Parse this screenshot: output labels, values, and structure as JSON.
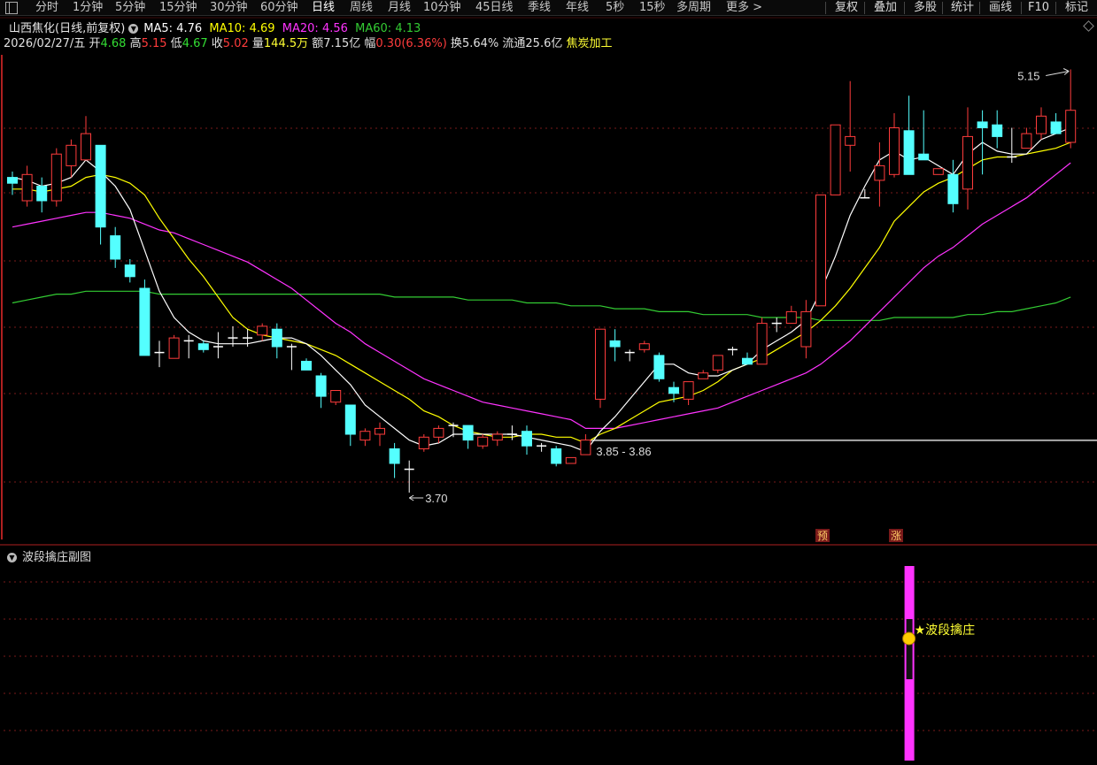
{
  "toolbar": {
    "periods": [
      "分时",
      "1分钟",
      "5分钟",
      "15分钟",
      "30分钟",
      "60分钟",
      "日线",
      "周线",
      "月线",
      "10分钟",
      "45日线",
      "季线",
      "年线",
      "5秒",
      "15秒",
      "多周期",
      "更多 >"
    ],
    "active": "日线",
    "right_buttons": [
      "复权",
      "叠加",
      "多股",
      "统计",
      "画线",
      "F10",
      "标记"
    ]
  },
  "header": {
    "stock": "山西焦化",
    "mode": "(日线,前复权)",
    "ma5": "MA5: 4.76",
    "ma10": "MA10: 4.69",
    "ma20": "MA20: 4.56",
    "ma60": "MA60: 4.13",
    "date": "2026/02/27/五",
    "open_label": "开",
    "open": "4.68",
    "high_label": "高",
    "high": "5.15",
    "low_label": "低",
    "low": "4.67",
    "close_label": "收",
    "close": "5.02",
    "vol_label": "量",
    "vol": "144.5万",
    "amt_label": "额",
    "amt": "7.15亿",
    "chg_label": "幅",
    "chg": "0.30(6.36%)",
    "turn_label": "换",
    "turn": "5.64%",
    "float_label": "流通",
    "float": "25.6亿",
    "industry": "焦炭加工"
  },
  "colors": {
    "up": "#ff3c3c",
    "down": "#54ffff",
    "ma5": "#ffffff",
    "ma10": "#ffff00",
    "ma20": "#ff33ff",
    "ma60": "#33cc33",
    "grid": "#7a1a1a",
    "sub_bar": "#ff33ff",
    "label_yellow": "#ffff33"
  },
  "chart_data": {
    "type": "candlestick",
    "y_range": [
      3.6,
      5.2
    ],
    "candles": [
      [
        4.78,
        4.8,
        4.72,
        4.76
      ],
      [
        4.7,
        4.82,
        4.68,
        4.79
      ],
      [
        4.75,
        4.78,
        4.66,
        4.7
      ],
      [
        4.7,
        4.88,
        4.68,
        4.86
      ],
      [
        4.82,
        4.91,
        4.78,
        4.89
      ],
      [
        4.84,
        4.99,
        4.84,
        4.93
      ],
      [
        4.89,
        4.89,
        4.55,
        4.61
      ],
      [
        4.58,
        4.61,
        4.47,
        4.5
      ],
      [
        4.48,
        4.5,
        4.42,
        4.44
      ],
      [
        4.4,
        4.43,
        4.19,
        4.17
      ],
      [
        4.18,
        4.22,
        4.13,
        4.17
      ],
      [
        4.16,
        4.24,
        4.16,
        4.23
      ],
      [
        4.22,
        4.24,
        4.16,
        4.22
      ],
      [
        4.21,
        4.22,
        4.18,
        4.19
      ],
      [
        4.2,
        4.25,
        4.16,
        4.2
      ],
      [
        4.22,
        4.27,
        4.2,
        4.23
      ],
      [
        4.22,
        4.26,
        4.2,
        4.23
      ],
      [
        4.24,
        4.28,
        4.22,
        4.27
      ],
      [
        4.26,
        4.28,
        4.16,
        4.2
      ],
      [
        4.2,
        4.21,
        4.12,
        4.2
      ],
      [
        4.15,
        4.16,
        4.12,
        4.12
      ],
      [
        4.1,
        4.11,
        3.99,
        4.03
      ],
      [
        4.01,
        4.05,
        4.0,
        4.05
      ],
      [
        4.0,
        4.0,
        3.86,
        3.9
      ],
      [
        3.88,
        3.92,
        3.86,
        3.91
      ],
      [
        3.9,
        3.94,
        3.86,
        3.92
      ],
      [
        3.85,
        3.87,
        3.75,
        3.8
      ],
      [
        3.78,
        3.81,
        3.7,
        3.78
      ],
      [
        3.85,
        3.9,
        3.84,
        3.89
      ],
      [
        3.89,
        3.93,
        3.87,
        3.92
      ],
      [
        3.92,
        3.94,
        3.89,
        3.93
      ],
      [
        3.93,
        3.93,
        3.85,
        3.88
      ],
      [
        3.86,
        3.9,
        3.85,
        3.89
      ],
      [
        3.88,
        3.91,
        3.86,
        3.9
      ],
      [
        3.9,
        3.93,
        3.88,
        3.9
      ],
      [
        3.91,
        3.93,
        3.83,
        3.86
      ],
      [
        3.85,
        3.87,
        3.84,
        3.86
      ],
      [
        3.85,
        3.86,
        3.79,
        3.8
      ],
      [
        3.8,
        3.82,
        3.81,
        3.82
      ],
      [
        3.83,
        3.9,
        3.83,
        3.88
      ],
      [
        4.02,
        4.26,
        3.99,
        4.26
      ],
      [
        4.22,
        4.26,
        4.15,
        4.2
      ],
      [
        4.17,
        4.19,
        4.15,
        4.18
      ],
      [
        4.19,
        4.22,
        4.18,
        4.21
      ],
      [
        4.17,
        4.18,
        4.08,
        4.09
      ],
      [
        4.06,
        4.08,
        4.01,
        4.04
      ],
      [
        4.02,
        4.08,
        4.0,
        4.08
      ],
      [
        4.09,
        4.12,
        4.09,
        4.11
      ],
      [
        4.12,
        4.17,
        4.11,
        4.17
      ],
      [
        4.18,
        4.2,
        4.17,
        4.19
      ],
      [
        4.16,
        4.18,
        4.14,
        4.14
      ],
      [
        4.14,
        4.3,
        4.14,
        4.28
      ],
      [
        4.28,
        4.3,
        4.25,
        4.28
      ],
      [
        4.28,
        4.34,
        4.29,
        4.32
      ],
      [
        4.2,
        4.36,
        4.16,
        4.32
      ],
      [
        4.34,
        4.72,
        4.34,
        4.72
      ],
      [
        4.72,
        4.96,
        4.72,
        4.96
      ],
      [
        4.89,
        5.11,
        4.8,
        4.92
      ],
      [
        4.71,
        4.74,
        4.71,
        4.71
      ],
      [
        4.77,
        4.9,
        4.68,
        4.82
      ],
      [
        4.79,
        5.0,
        4.78,
        4.95
      ],
      [
        4.94,
        5.06,
        4.86,
        4.79
      ],
      [
        4.86,
        5.01,
        4.86,
        4.84
      ],
      [
        4.79,
        4.81,
        4.79,
        4.81
      ],
      [
        4.79,
        4.84,
        4.66,
        4.69
      ],
      [
        4.74,
        5.02,
        4.67,
        4.92
      ],
      [
        4.97,
        5.01,
        4.79,
        4.95
      ],
      [
        4.96,
        5.01,
        4.88,
        4.92
      ],
      [
        4.85,
        4.95,
        4.83,
        4.84
      ],
      [
        4.88,
        4.95,
        4.88,
        4.93
      ],
      [
        4.93,
        5.02,
        4.91,
        4.99
      ],
      [
        4.97,
        5.0,
        4.93,
        4.93
      ],
      [
        4.9,
        5.15,
        4.88,
        5.01
      ]
    ],
    "ma5": [
      4.78,
      4.77,
      4.75,
      4.76,
      4.78,
      4.84,
      4.8,
      4.75,
      4.67,
      4.53,
      4.39,
      4.3,
      4.25,
      4.22,
      4.21,
      4.21,
      4.21,
      4.22,
      4.23,
      4.23,
      4.21,
      4.17,
      4.12,
      4.07,
      4.0,
      3.96,
      3.92,
      3.88,
      3.86,
      3.87,
      3.9,
      3.9,
      3.9,
      3.9,
      3.9,
      3.89,
      3.88,
      3.87,
      3.86,
      3.84,
      3.91,
      3.96,
      4.02,
      4.08,
      4.14,
      4.14,
      4.11,
      4.1,
      4.1,
      4.12,
      4.14,
      4.19,
      4.22,
      4.25,
      4.29,
      4.39,
      4.51,
      4.65,
      4.75,
      4.84,
      4.87,
      4.84,
      4.85,
      4.82,
      4.79,
      4.86,
      4.9,
      4.87,
      4.86,
      4.86,
      4.91,
      4.93,
      4.95
    ],
    "ma10": [
      4.74,
      4.74,
      4.73,
      4.74,
      4.75,
      4.78,
      4.79,
      4.78,
      4.76,
      4.72,
      4.64,
      4.57,
      4.5,
      4.44,
      4.37,
      4.3,
      4.26,
      4.24,
      4.23,
      4.22,
      4.21,
      4.19,
      4.17,
      4.14,
      4.11,
      4.08,
      4.05,
      4.02,
      3.98,
      3.96,
      3.93,
      3.91,
      3.9,
      3.89,
      3.89,
      3.9,
      3.9,
      3.89,
      3.89,
      3.87,
      3.9,
      3.92,
      3.95,
      3.98,
      4.01,
      4.02,
      4.03,
      4.05,
      4.08,
      4.12,
      4.14,
      4.16,
      4.19,
      4.22,
      4.25,
      4.29,
      4.34,
      4.4,
      4.47,
      4.54,
      4.63,
      4.68,
      4.73,
      4.76,
      4.78,
      4.81,
      4.84,
      4.85,
      4.85,
      4.86,
      4.87,
      4.88,
      4.9
    ],
    "ma20": [
      4.61,
      4.62,
      4.63,
      4.64,
      4.65,
      4.66,
      4.66,
      4.65,
      4.64,
      4.62,
      4.6,
      4.59,
      4.57,
      4.55,
      4.53,
      4.51,
      4.49,
      4.46,
      4.43,
      4.4,
      4.36,
      4.32,
      4.28,
      4.25,
      4.21,
      4.18,
      4.15,
      4.12,
      4.09,
      4.07,
      4.05,
      4.03,
      4.01,
      4.0,
      3.99,
      3.98,
      3.97,
      3.96,
      3.95,
      3.92,
      3.92,
      3.92,
      3.93,
      3.94,
      3.95,
      3.96,
      3.97,
      3.98,
      3.99,
      4.01,
      4.03,
      4.05,
      4.07,
      4.09,
      4.11,
      4.14,
      4.18,
      4.22,
      4.27,
      4.32,
      4.37,
      4.42,
      4.47,
      4.51,
      4.54,
      4.58,
      4.62,
      4.65,
      4.68,
      4.71,
      4.75,
      4.79,
      4.83
    ],
    "ma60": [
      4.35,
      4.36,
      4.37,
      4.38,
      4.38,
      4.39,
      4.39,
      4.39,
      4.39,
      4.39,
      4.38,
      4.38,
      4.38,
      4.38,
      4.38,
      4.38,
      4.38,
      4.38,
      4.38,
      4.38,
      4.38,
      4.38,
      4.38,
      4.38,
      4.38,
      4.38,
      4.37,
      4.37,
      4.37,
      4.37,
      4.37,
      4.36,
      4.36,
      4.36,
      4.36,
      4.35,
      4.35,
      4.35,
      4.34,
      4.34,
      4.34,
      4.33,
      4.33,
      4.33,
      4.32,
      4.32,
      4.32,
      4.31,
      4.31,
      4.31,
      4.31,
      4.3,
      4.3,
      4.3,
      4.3,
      4.29,
      4.29,
      4.29,
      4.29,
      4.29,
      4.3,
      4.3,
      4.3,
      4.3,
      4.3,
      4.31,
      4.31,
      4.32,
      4.32,
      4.33,
      4.34,
      4.35,
      4.37
    ],
    "annotations": {
      "high_label": "5.15",
      "low_label": "3.70",
      "range_label": "3.85 - 3.86",
      "marker_yu": "预",
      "marker_zhang": "涨"
    },
    "sub_chart": {
      "title": "波段擒庄副图",
      "signal_label": "★波段擒庄",
      "signal_index": 61
    }
  }
}
